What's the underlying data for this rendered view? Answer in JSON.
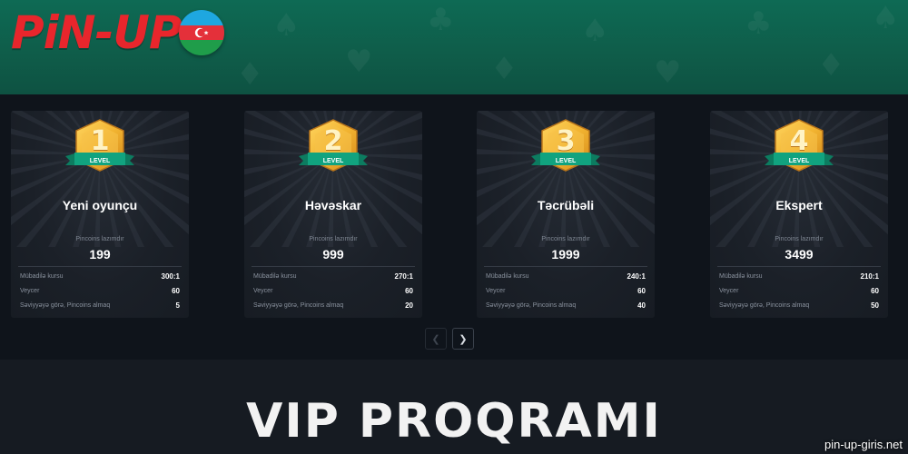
{
  "header": {
    "logo_text": "PiN-UP",
    "flag": "azerbaijan-flag"
  },
  "levels": [
    {
      "level_no": "1",
      "level_word": "LEVEL",
      "title": "Yeni oyunçu",
      "pincoins_label": "Pincoins lazımdır",
      "pincoins": "199",
      "rows": [
        {
          "label": "Mübadilə kursu",
          "value": "300:1"
        },
        {
          "label": "Veycer",
          "value": "60"
        },
        {
          "label": "Səviyyəyə görə, Pincoins almaq",
          "value": "5"
        }
      ]
    },
    {
      "level_no": "2",
      "level_word": "LEVEL",
      "title": "Həvəskar",
      "pincoins_label": "Pincoins lazımdır",
      "pincoins": "999",
      "rows": [
        {
          "label": "Mübadilə kursu",
          "value": "270:1"
        },
        {
          "label": "Veycer",
          "value": "60"
        },
        {
          "label": "Səviyyəyə görə, Pincoins almaq",
          "value": "20"
        }
      ]
    },
    {
      "level_no": "3",
      "level_word": "LEVEL",
      "title": "Təcrübəli",
      "pincoins_label": "Pincoins lazımdır",
      "pincoins": "1999",
      "rows": [
        {
          "label": "Mübadilə kursu",
          "value": "240:1"
        },
        {
          "label": "Veycer",
          "value": "60"
        },
        {
          "label": "Səviyyəyə görə, Pincoins almaq",
          "value": "40"
        }
      ]
    },
    {
      "level_no": "4",
      "level_word": "LEVEL",
      "title": "Ekspert",
      "pincoins_label": "Pincoins lazımdır",
      "pincoins": "3499",
      "rows": [
        {
          "label": "Mübadilə kursu",
          "value": "210:1"
        },
        {
          "label": "Veycer",
          "value": "60"
        },
        {
          "label": "Səviyyəyə görə, Pincoins almaq",
          "value": "50"
        }
      ]
    }
  ],
  "pager": {
    "prev_icon": "chevron-left-icon",
    "next_icon": "chevron-right-icon"
  },
  "section_title": "VIP PROQRAMI",
  "watermark": "pin-up-giris.net",
  "colors": {
    "header_green": "#0f5c49",
    "logo_red": "#e8262c",
    "ribbon_green": "#11a37f",
    "badge_gold": "#f2b431"
  }
}
